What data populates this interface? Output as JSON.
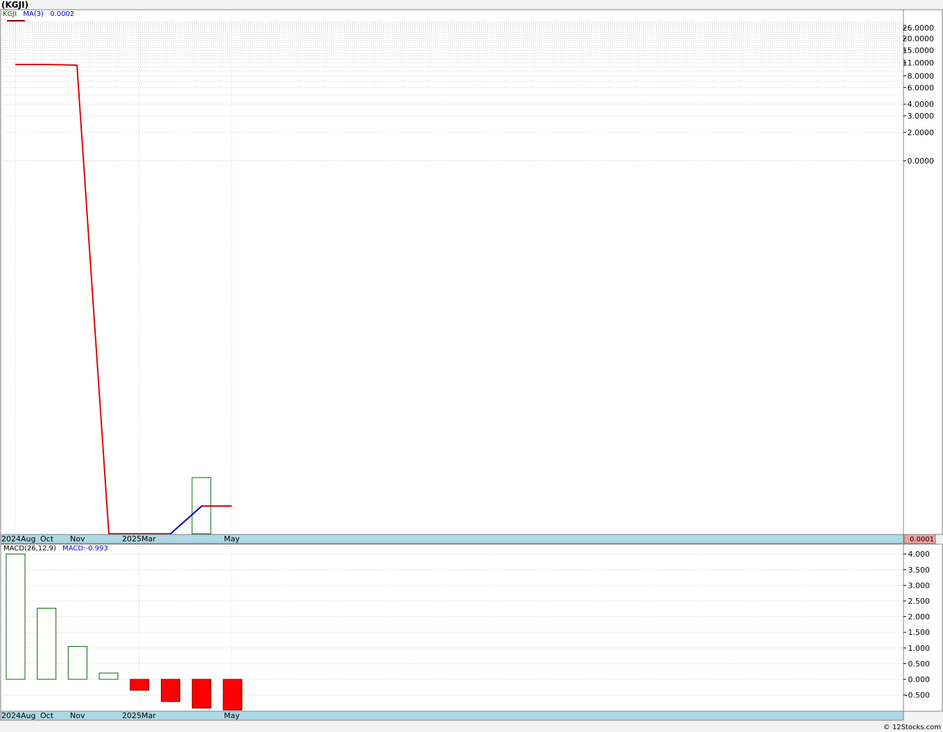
{
  "title": "(KGJI)",
  "copyright": "© 12Stocks.com",
  "colors": {
    "price_line": "#e00000",
    "ma_line": "#0000e0",
    "up_bar": "#006400",
    "down_fill": "#ff0000",
    "axis_band": "#add8e6",
    "last_value_bg": "#f4a0a0"
  },
  "chart_data": [
    {
      "type": "line",
      "name": "price",
      "scale": "log",
      "legend": {
        "symbol": "KGJI",
        "ma_label": "MA(3)",
        "ma_value": "0.0002"
      },
      "y_ticks": [
        "26.0000",
        "20.0000",
        "15.0000",
        "11.0000",
        "8.0000",
        "6.0000",
        "4.0000",
        "3.0000",
        "2.0000",
        "0.0000"
      ],
      "x_labels": [
        "2024Aug",
        "Oct",
        "Nov",
        "2025Mar",
        "May"
      ],
      "last_value": "0.0001",
      "x": [
        "2024-08",
        "2024-09",
        "2024-10",
        "2024-11",
        "2024-12",
        "2025-01",
        "2025-02",
        "2025-03",
        "2025-04"
      ],
      "series": [
        {
          "name": "KGJI",
          "values": [
            10.0,
            10.0,
            9.9,
            0.0001,
            0.0001,
            0.0001,
            0.0001,
            0.0002,
            0.0002
          ]
        },
        {
          "name": "MA(3)",
          "values": [
            null,
            null,
            null,
            null,
            null,
            0.0001,
            0.0001,
            0.0002,
            null
          ]
        }
      ],
      "bars": [
        {
          "x": "2025-03",
          "value": 0.0003
        }
      ]
    },
    {
      "type": "bar",
      "name": "macd",
      "legend": {
        "label": "MACD(26,12,9)",
        "value_label": "MACD:-0.993"
      },
      "y_ticks": [
        "4.000",
        "3.500",
        "3.000",
        "2.500",
        "2.000",
        "1.500",
        "1.000",
        "0.500",
        "0.000",
        "-0.500"
      ],
      "x_labels": [
        "2024Aug",
        "Oct",
        "Nov",
        "2025Mar",
        "May"
      ],
      "ylim": [
        -1.0,
        4.3
      ],
      "categories": [
        "2024-08",
        "2024-09",
        "2024-10",
        "2024-11",
        "2024-12",
        "2025-01",
        "2025-02",
        "2025-03"
      ],
      "values": [
        4.0,
        2.27,
        1.05,
        0.2,
        -0.35,
        -0.71,
        -0.92,
        -0.98
      ]
    }
  ]
}
